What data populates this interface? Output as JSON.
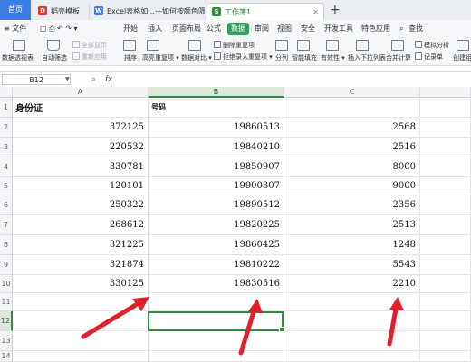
{
  "tabs": {
    "home": "首页",
    "template": "稻壳模板",
    "excel": "Excel表格如...—如何按颜色筛选",
    "workbook": "工作簿1",
    "add": "+"
  },
  "menu": {
    "items": [
      "开始",
      "插入",
      "页面布局",
      "公式",
      "数据",
      "审阅",
      "视图",
      "安全",
      "开发工具",
      "特色应用",
      "查找"
    ],
    "active": "数据",
    "hamburger": "≡ 文件"
  },
  "ribbon": {
    "pivot": "数据透视表",
    "autofilter": "自动筛选",
    "show_all": "全部显示",
    "reapply": "重新应用",
    "sort": "排序",
    "highlight_dup": "高亮重复项",
    "data_compare": "数据对比",
    "delete_dup": "删除重复项",
    "reject_dup": "拒绝录入重复项",
    "split": "分列",
    "smart_fill": "智能填充",
    "validity": "有效性",
    "insert_dropdown": "插入下拉列表",
    "consolidate": "合并计算",
    "simulate": "模拟分析",
    "record": "记录单",
    "create_group": "创建组"
  },
  "formula_bar": {
    "cell_ref": "B12",
    "fx": "fx",
    "formula": ""
  },
  "grid": {
    "columns": [
      "A",
      "B",
      "C"
    ],
    "selected_column": "B",
    "selected_row": "12",
    "row_numbers": [
      "1",
      "2",
      "3",
      "4",
      "5",
      "6",
      "7",
      "8",
      "9",
      "10",
      "11",
      "12",
      "13",
      "14"
    ],
    "header_row": [
      "身份证",
      "号码",
      ""
    ],
    "rows": [
      [
        "372125",
        "19860513",
        "2568"
      ],
      [
        "220532",
        "19840210",
        "2516"
      ],
      [
        "330781",
        "19850907",
        "8000"
      ],
      [
        "120101",
        "19900307",
        "9000"
      ],
      [
        "250322",
        "19890512",
        "2356"
      ],
      [
        "268612",
        "19820225",
        "2513"
      ],
      [
        "321225",
        "19860425",
        "1248"
      ],
      [
        "321874",
        "19810222",
        "5543"
      ],
      [
        "330125",
        "19830516",
        "2210"
      ]
    ]
  },
  "colors": {
    "accent_green": "#2e8b3f",
    "annotation_red": "#e0202a",
    "home_tab_blue": "#3c7de6"
  }
}
